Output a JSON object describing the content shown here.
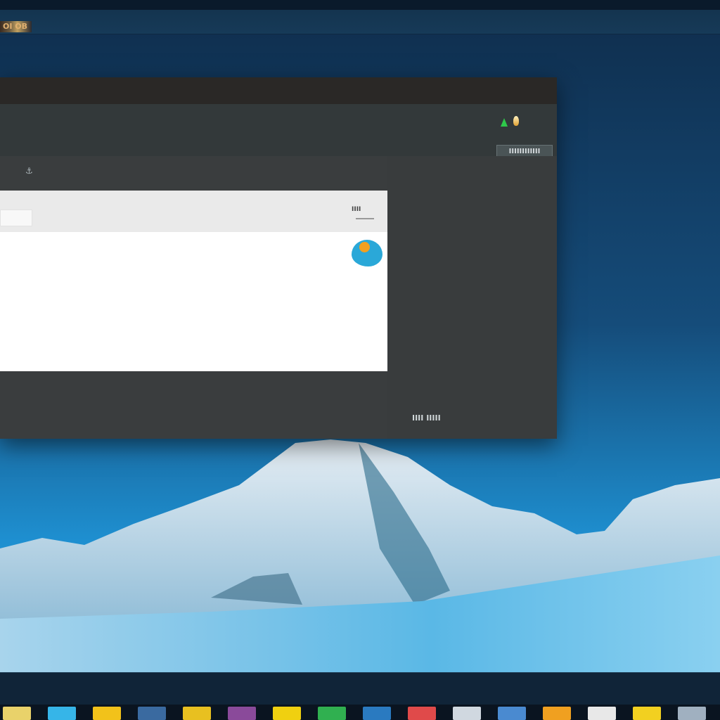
{
  "topbar": {
    "label": "OI OB"
  },
  "window": {
    "header_button_label": "IIIIIIIIIIII",
    "toolbar_icon": "⚓",
    "panel": {
      "badge_text": "IIII"
    },
    "footer_text": "IIII IIIII"
  },
  "icons": {
    "status_green": "triangle-icon",
    "status_flame": "flame-icon",
    "toolbar": "anchor-icon",
    "bubble": "chat-bubble-icon"
  },
  "taskbar": {
    "items": [
      {
        "name": "app-1",
        "color": "#e9d26a"
      },
      {
        "name": "app-2",
        "color": "#36b5e8"
      },
      {
        "name": "app-3",
        "color": "#f2c21a"
      },
      {
        "name": "app-4",
        "color": "#3a6aa0"
      },
      {
        "name": "app-5",
        "color": "#e8c020"
      },
      {
        "name": "app-6",
        "color": "#8a4a9a"
      },
      {
        "name": "app-7",
        "color": "#f0d010"
      },
      {
        "name": "app-8",
        "color": "#30b050"
      },
      {
        "name": "app-9",
        "color": "#2a7ac0"
      },
      {
        "name": "app-10",
        "color": "#e04a4a"
      },
      {
        "name": "app-11",
        "color": "#d0d8e0"
      },
      {
        "name": "app-12",
        "color": "#4a8ad0"
      },
      {
        "name": "app-13",
        "color": "#f0a020"
      },
      {
        "name": "app-14",
        "color": "#e8e8e8"
      },
      {
        "name": "app-15",
        "color": "#f2d020"
      },
      {
        "name": "app-16",
        "color": "#a0b0c0"
      }
    ]
  },
  "colors": {
    "sky_top": "#0f2d4c",
    "sky_bottom": "#1e8fd0",
    "window_bg": "#3a3d3e",
    "snow": "#dce8f0"
  }
}
